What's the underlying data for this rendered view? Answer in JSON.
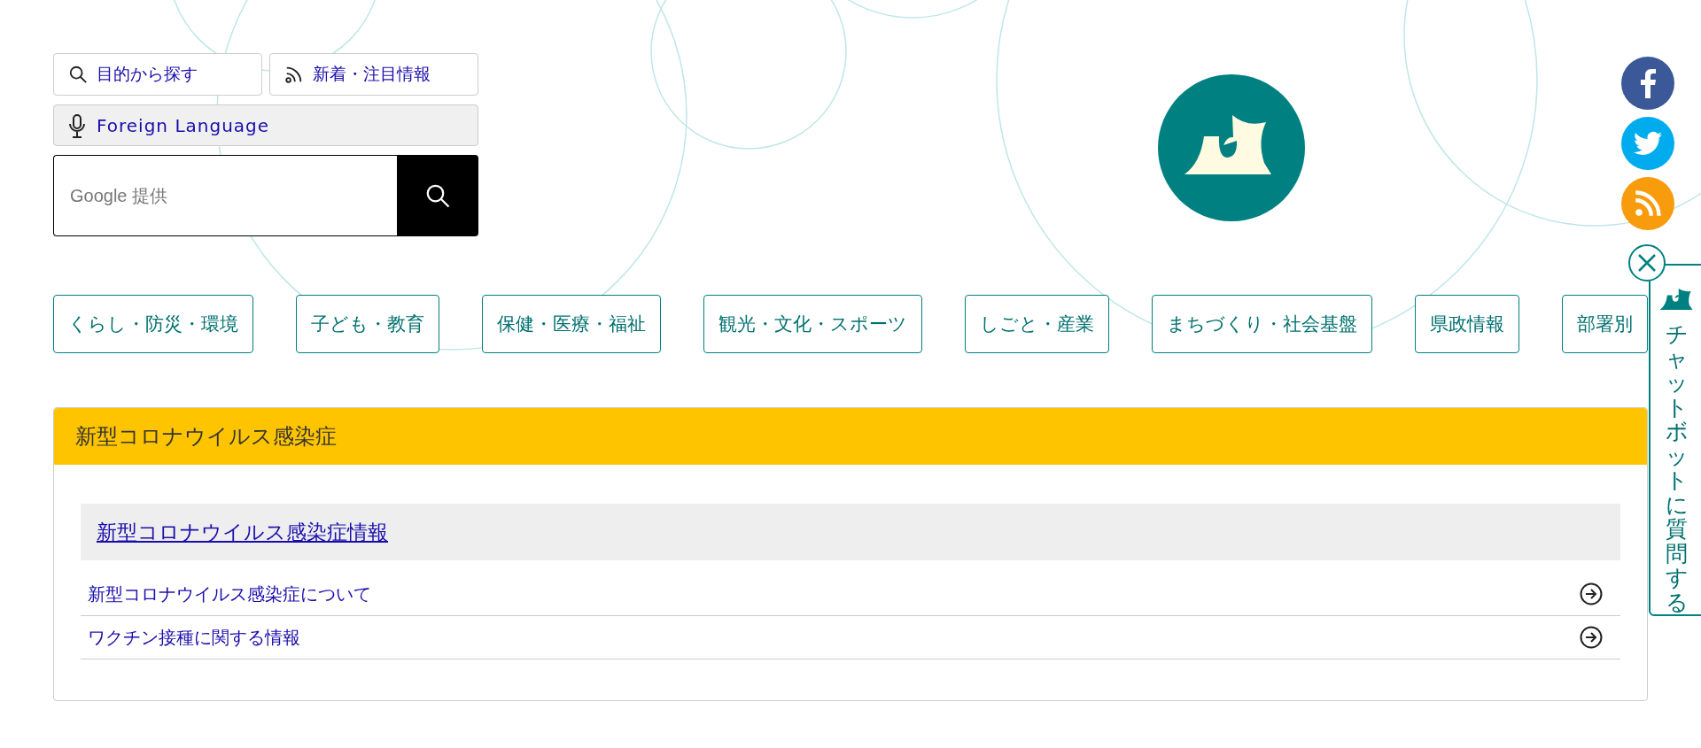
{
  "top_links": [
    {
      "label": "目的から探す",
      "kind": "search"
    },
    {
      "label": "新着・注目情報",
      "kind": "rss"
    }
  ],
  "language_button": {
    "label": "Foreign Language"
  },
  "search": {
    "placeholder": "Google 提供"
  },
  "social": [
    {
      "kind": "facebook",
      "color": "#3b5998"
    },
    {
      "kind": "twitter",
      "color": "#00acee"
    },
    {
      "kind": "rss",
      "color": "#f89c0e"
    }
  ],
  "nav": [
    "くらし・防災・環境",
    "子ども・教育",
    "保健・医療・福祉",
    "観光・文化・スポーツ",
    "しごと・産業",
    "まちづくり・社会基盤",
    "県政情報",
    "部署別"
  ],
  "panel": {
    "title": "新型コロナウイルス感染症",
    "section_title": "新型コロナウイルス感染症情報",
    "links": [
      "新型コロナウイルス感染症について",
      "ワクチン接種に関する情報"
    ]
  },
  "chatbot": {
    "label": "チャットボットに質問する"
  }
}
